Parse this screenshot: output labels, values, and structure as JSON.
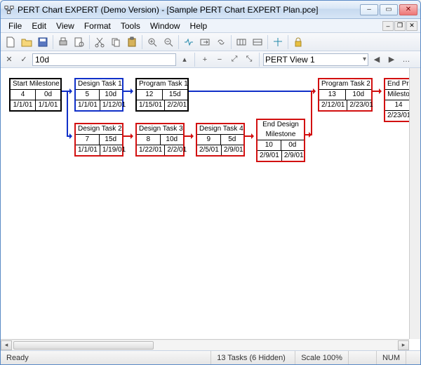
{
  "window": {
    "title": "PERT Chart EXPERT (Demo Version) - [Sample PERT Chart EXPERT Plan.pce]"
  },
  "menu": {
    "items": [
      "File",
      "Edit",
      "View",
      "Format",
      "Tools",
      "Window",
      "Help"
    ]
  },
  "toolbar2": {
    "input_value": "10d",
    "view_selected": "PERT View 1"
  },
  "nodes": {
    "start": {
      "title": "Start Milestone",
      "id": "4",
      "dur": "0d",
      "s": "1/1/01",
      "e": "1/1/01"
    },
    "d1": {
      "title": "Design Task 1",
      "id": "5",
      "dur": "10d",
      "s": "1/1/01",
      "e": "1/12/01"
    },
    "p1": {
      "title": "Program Task 1",
      "id": "12",
      "dur": "15d",
      "s": "1/15/01",
      "e": "2/2/01"
    },
    "p2": {
      "title": "Program Task 2",
      "id": "13",
      "dur": "10d",
      "s": "2/12/01",
      "e": "2/23/01"
    },
    "endprog": {
      "title": "End Prog",
      "title2": "Milesto",
      "id": "14",
      "dur": "",
      "s": "2/23/01",
      "e": ""
    },
    "d2": {
      "title": "Design Task 2",
      "id": "7",
      "dur": "15d",
      "s": "1/1/01",
      "e": "1/19/01"
    },
    "d3": {
      "title": "Design Task 3",
      "id": "8",
      "dur": "10d",
      "s": "1/22/01",
      "e": "2/2/01"
    },
    "d4": {
      "title": "Design Task 4",
      "id": "9",
      "dur": "5d",
      "s": "2/5/01",
      "e": "2/9/01"
    },
    "enddes": {
      "title": "End Design",
      "title2": "Milestone",
      "id": "10",
      "dur": "0d",
      "s": "2/9/01",
      "e": "2/9/01"
    }
  },
  "status": {
    "ready": "Ready",
    "tasks": "13 Tasks (6 Hidden)",
    "scale": "Scale 100%",
    "num": "NUM"
  }
}
